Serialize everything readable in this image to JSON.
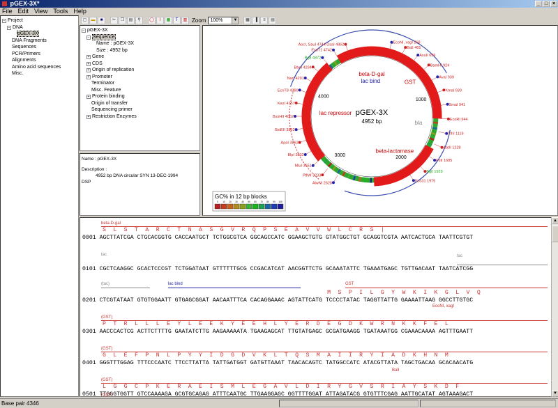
{
  "window": {
    "title": "pGEX-3X*"
  },
  "menu": [
    "File",
    "Edit",
    "View",
    "Tools",
    "Help"
  ],
  "project_tree": [
    {
      "label": "Project",
      "indent": 0,
      "exp": "−"
    },
    {
      "label": "DNA",
      "indent": 1,
      "exp": "−"
    },
    {
      "label": "pGEX-3X",
      "indent": 3,
      "selected": true
    },
    {
      "label": "DNA Fragments",
      "indent": 2
    },
    {
      "label": "Sequences",
      "indent": 2
    },
    {
      "label": "PCR/Primers",
      "indent": 2
    },
    {
      "label": "Alignments",
      "indent": 2
    },
    {
      "label": "Amino acid sequences",
      "indent": 2
    },
    {
      "label": "Misc.",
      "indent": 2
    }
  ],
  "zoom": {
    "label": "Zoom",
    "value": "100%"
  },
  "feature_tree": [
    {
      "label": "pGEX-3X",
      "indent": 0,
      "exp": "−"
    },
    {
      "label": "Sequence",
      "indent": 1,
      "exp": "−",
      "selected": true
    },
    {
      "label": "Name : pGEX-3X",
      "indent": 3
    },
    {
      "label": "Size : 4952 bp",
      "indent": 3
    },
    {
      "label": "Gene",
      "indent": 1,
      "exp": "+"
    },
    {
      "label": "CDS",
      "indent": 1,
      "exp": "+"
    },
    {
      "label": "Origin of replication",
      "indent": 1,
      "exp": "+"
    },
    {
      "label": "Promoter",
      "indent": 1,
      "exp": "+"
    },
    {
      "label": "Terminator",
      "indent": 2
    },
    {
      "label": "Misc. Feature",
      "indent": 2
    },
    {
      "label": "Protein binding",
      "indent": 1,
      "exp": "+"
    },
    {
      "label": "Origin of transfer",
      "indent": 2
    },
    {
      "label": "Sequencing primer",
      "indent": 2
    },
    {
      "label": "Restriction Enzymes",
      "indent": 1,
      "exp": "+"
    }
  ],
  "info": {
    "name": "Name : pGEX-3X",
    "desc_label": "Description :",
    "desc": "4952 bp    DNA    circular SYN 13-DEC-1994",
    "dsp": "DSP"
  },
  "map": {
    "name": "pGEX-3X",
    "size": "4952 bp",
    "ticks": [
      "1000",
      "2000",
      "3000",
      "4000"
    ],
    "features": [
      "beta-D-gal",
      "lac bind",
      "GST",
      "lac repressor",
      "beta-lactamase",
      "bla"
    ],
    "gc_legend": {
      "title": "GC% in 12 bp blocks",
      "scale": [
        "0",
        "10",
        "20",
        "30",
        "40",
        "50",
        "60",
        "70",
        "80",
        "90",
        "100"
      ],
      "colors": [
        "#b22222",
        "#c83c1e",
        "#c8641e",
        "#b48c1e",
        "#8ca01e",
        "#3cb43c",
        "#1eb41e",
        "#1ea050",
        "#1e64a0",
        "#1e3cb4",
        "#1e1e96"
      ]
    },
    "sites_left": [
      "AocI, SauI 4744 DsaI 4862",
      "EcoT1 4742",
      "BglI 4872",
      "BbeI 4294",
      "NarI 4291",
      "EcoT8 4290",
      "KasI 4157",
      "BssHII 4062",
      "BstEII 3862",
      "ApaI 3862",
      "BlpI 3832",
      "MluI 3651",
      "PflMI 3233",
      "AlwNI 2628"
    ],
    "sites_right": [
      "EcoNI, xagI 268",
      "BalI 465",
      "AsuII 659",
      "BamHI 924",
      "AvaI 939",
      "XmaI 939",
      "SmaI 941",
      "EcoRI 944",
      "TthI 1119",
      "AatII 1228",
      "PstI 1685",
      "BglI 1929",
      "Eco31 1975"
    ]
  },
  "sequence": {
    "rows": [
      {
        "num": "0001",
        "dna": "AGCTTATCGA CTGCACGGTG CACCAATGCT TCTGGCGTCA GGCAGCCATC GGAAGCTGTG GTATGGCTGT GCAGGTCGTA AATCACTGCA TAATTCGTGT",
        "feat": "beta-D-gal",
        "aa": "S  L  S  T  A  R  C  T  N  A  S  G  V  R  Q  P  S  E  A  V  V  W  L  C  R  S  |"
      },
      {
        "num": "0101",
        "dna": "CGCTCAAGGC GCACTCCCGT TCTGGATAAT GTTTTTTGCG CCGACATCAT AACGGTTCTG GCAAATATTC TGAAATGAGC TGTTGACAAT TAATCATCGG",
        "feat": "tac"
      },
      {
        "num": "0201",
        "dna": "CTCGTATAAT GTGTGGAATT GTGAGCGGAT AACAATTTCA CACAGGAAAC AGTATTCATG TCCCCTATAC TAGGTTATTG GAAAATTAAG GGCCTTGTGC",
        "feat_tac": "(tac)",
        "feat_lac": "lac bind",
        "feat_gst": "GST",
        "site": "EcoNI, xagI",
        "aa": "                                                               M  S  P  I  L  G  Y  W  K  I  K  G  L  V  Q"
      },
      {
        "num": "0301",
        "dna": "AACCCACTCG ACTTCTTTTG GAATATCTTG AAGAAAAATA TGAAGAGCAT TTGTATGAGC GCGATGAAGG TGATAAATGG CGAAACAAAA AGTTTGAATT",
        "feat": "(GST)",
        "aa": "P  T  R  L  L  L  E  Y  L  E  E  K  Y  E  E  H  L  Y  E  R  D  E  G  D  K  W  R  N  K  K  F  E  L"
      },
      {
        "num": "0401",
        "dna": "GGGTTTGGAG TTTCCCAATC TTCCTTATTA TATTGATGGT GATGTTAAAT TAACACAGTC TATGGCCATC ATACGTTATA TAGCTGACAA GCACAACATG",
        "feat": "(GST)",
        "site": "BalI",
        "aa": "G  L  E  F  P  N  L  P  Y  Y  I  D  G  D  V  K  L  T  Q  S  M  A  I  I  R  Y  I  A  D  K  H  N  M"
      },
      {
        "num": "0501",
        "dna": "TTGGGTGGTT GTCCAAAAGA GCGTGCAGAG ATTTCAATGC TTGAAGGAGC GGTTTTGGAT ATTAGATACG GTGTTTCGAG AATTGCATAT AGTAAAGACT",
        "feat": "(GST)",
        "aa": "L  G  G  C  P  K  E  R  A  E  I  S  M  L  E  G  A  V  L  D  I  R  Y  G  V  S  R  I  A  Y  S  K  D  F"
      }
    ],
    "next_feat": "(GST)"
  },
  "status": {
    "text": "Base pair 4346"
  }
}
